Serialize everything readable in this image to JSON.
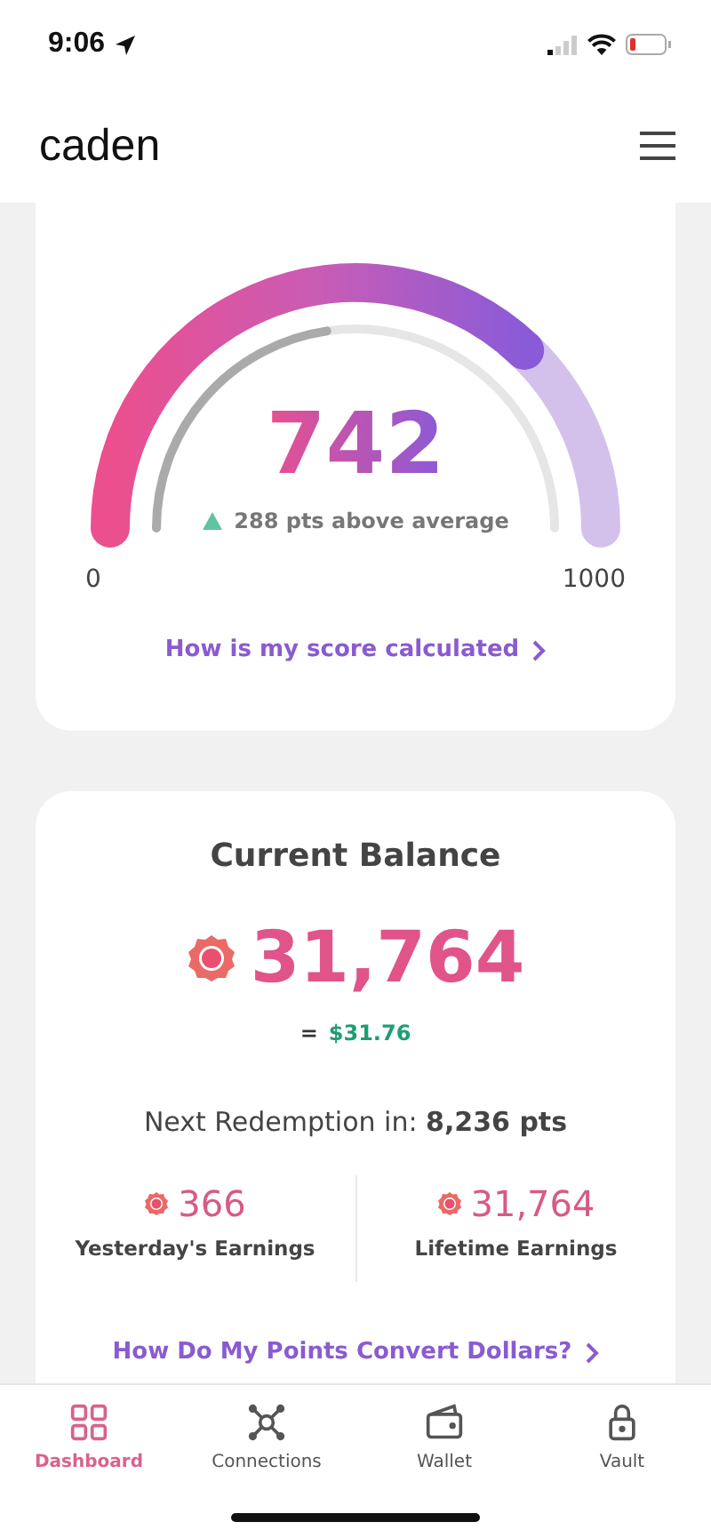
{
  "status_bar": {
    "time": "9:06"
  },
  "header": {
    "logo": "caden"
  },
  "score_card": {
    "score": "742",
    "comparison": "288 pts above average",
    "min_label": "0",
    "max_label": "1000",
    "link": "How is my score calculated"
  },
  "balance_card": {
    "title": "Current Balance",
    "points": "31,764",
    "equals": "=",
    "dollar_value": "$31.76",
    "next_redemption": "Next Redemption in: **8,236 pts**",
    "stats": [
      {
        "value": "366",
        "label": "Yesterday's Earnings"
      },
      {
        "value": "31,764",
        "label": "Lifetime Earnings"
      }
    ],
    "link": "How Do My Points Convert Dollars?"
  },
  "nav": [
    {
      "label": "Dashboard",
      "kind": "grid",
      "selected": true
    },
    {
      "label": "Connections",
      "kind": "network",
      "selected": false
    },
    {
      "label": "Wallet",
      "kind": "wallet",
      "selected": false
    },
    {
      "label": "Vault",
      "kind": "lock",
      "selected": false
    }
  ]
}
